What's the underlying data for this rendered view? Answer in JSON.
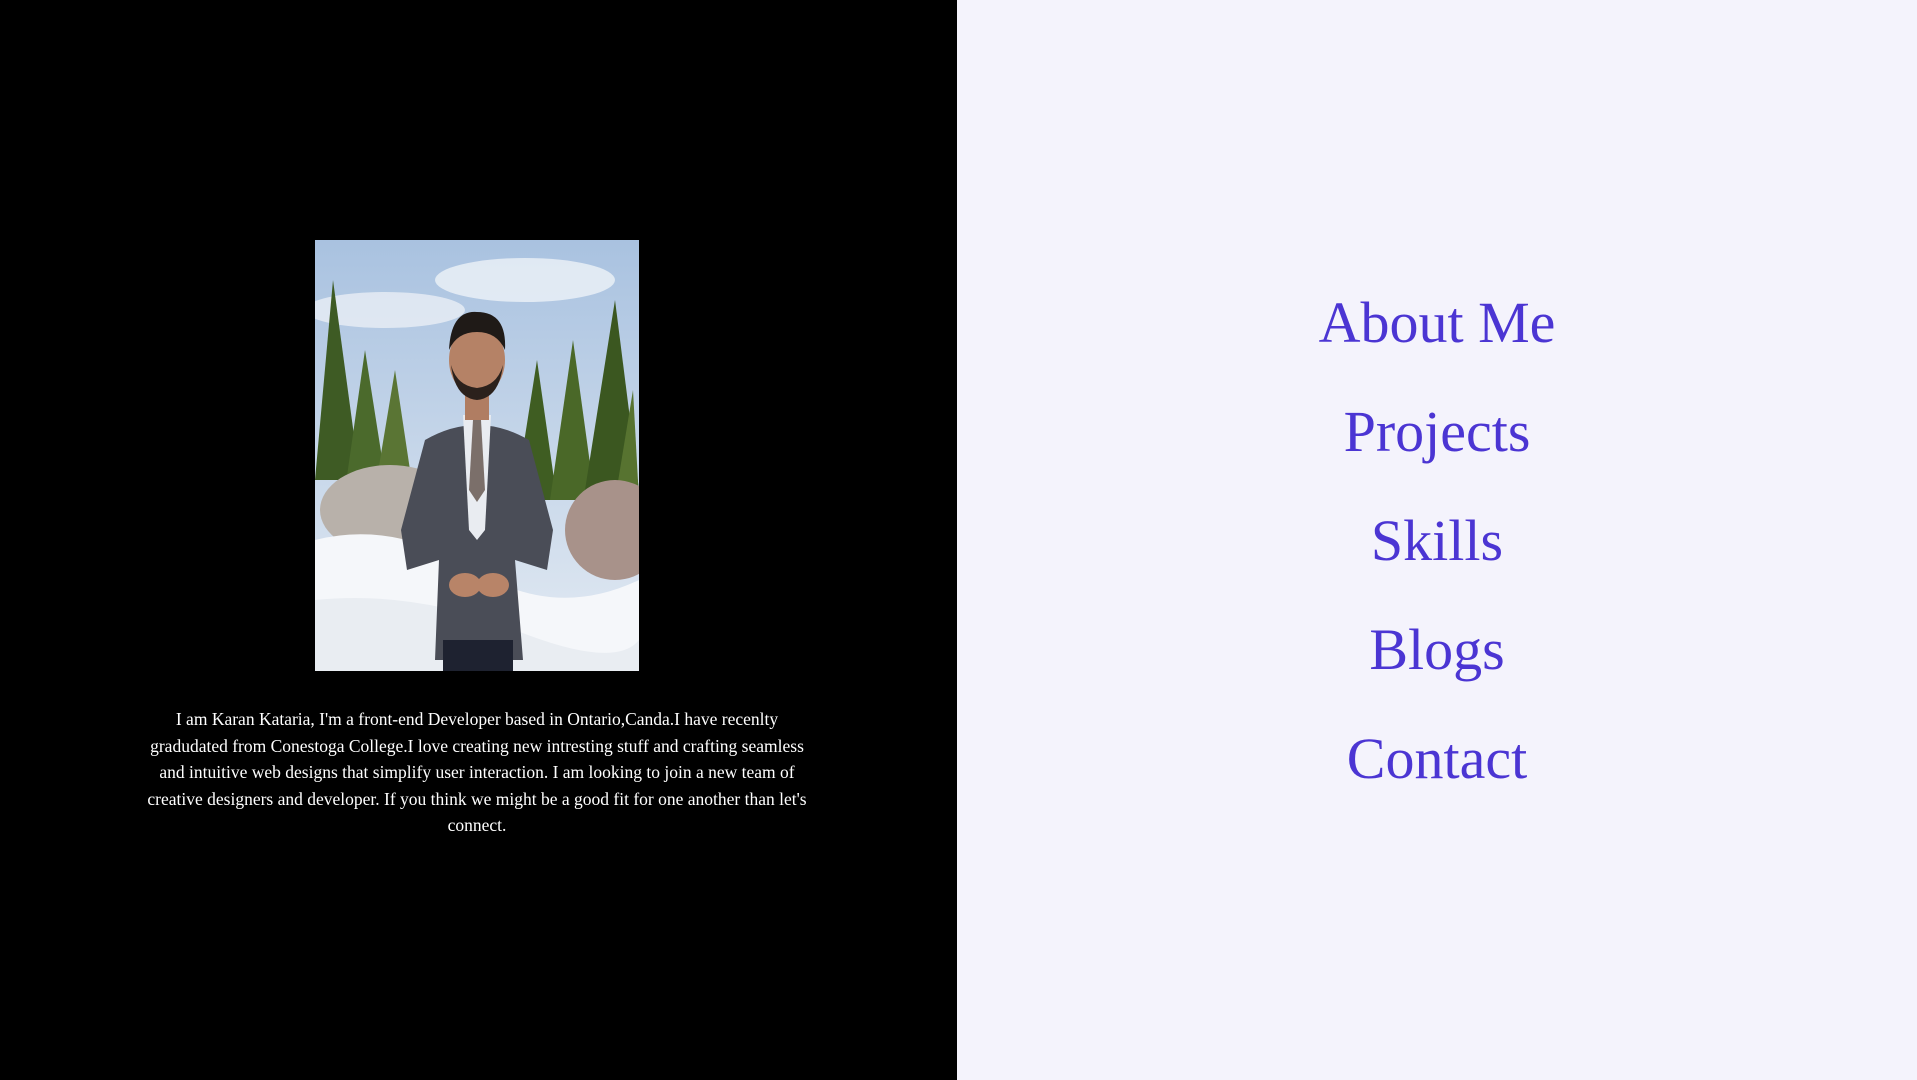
{
  "profile": {
    "photo_icon": "portrait-photo",
    "bio": "I am Karan Kataria, I'm a front-end Developer based in Ontario,Canda.I have recenlty gradudated from Conestoga College.I love creating new intresting stuff and crafting seamless and intuitive web designs that simplify user interaction. I am looking to join a new team of creative designers and developer. If you think we might be a good fit for one another than let's connect."
  },
  "nav": {
    "items": [
      {
        "label": "About Me"
      },
      {
        "label": "Projects"
      },
      {
        "label": "Skills"
      },
      {
        "label": "Blogs"
      },
      {
        "label": "Contact"
      }
    ]
  },
  "colors": {
    "left_background": "#000000",
    "right_background": "#f4f3fc",
    "nav_link": "#4b35d3",
    "bio_text": "#ffffff"
  }
}
